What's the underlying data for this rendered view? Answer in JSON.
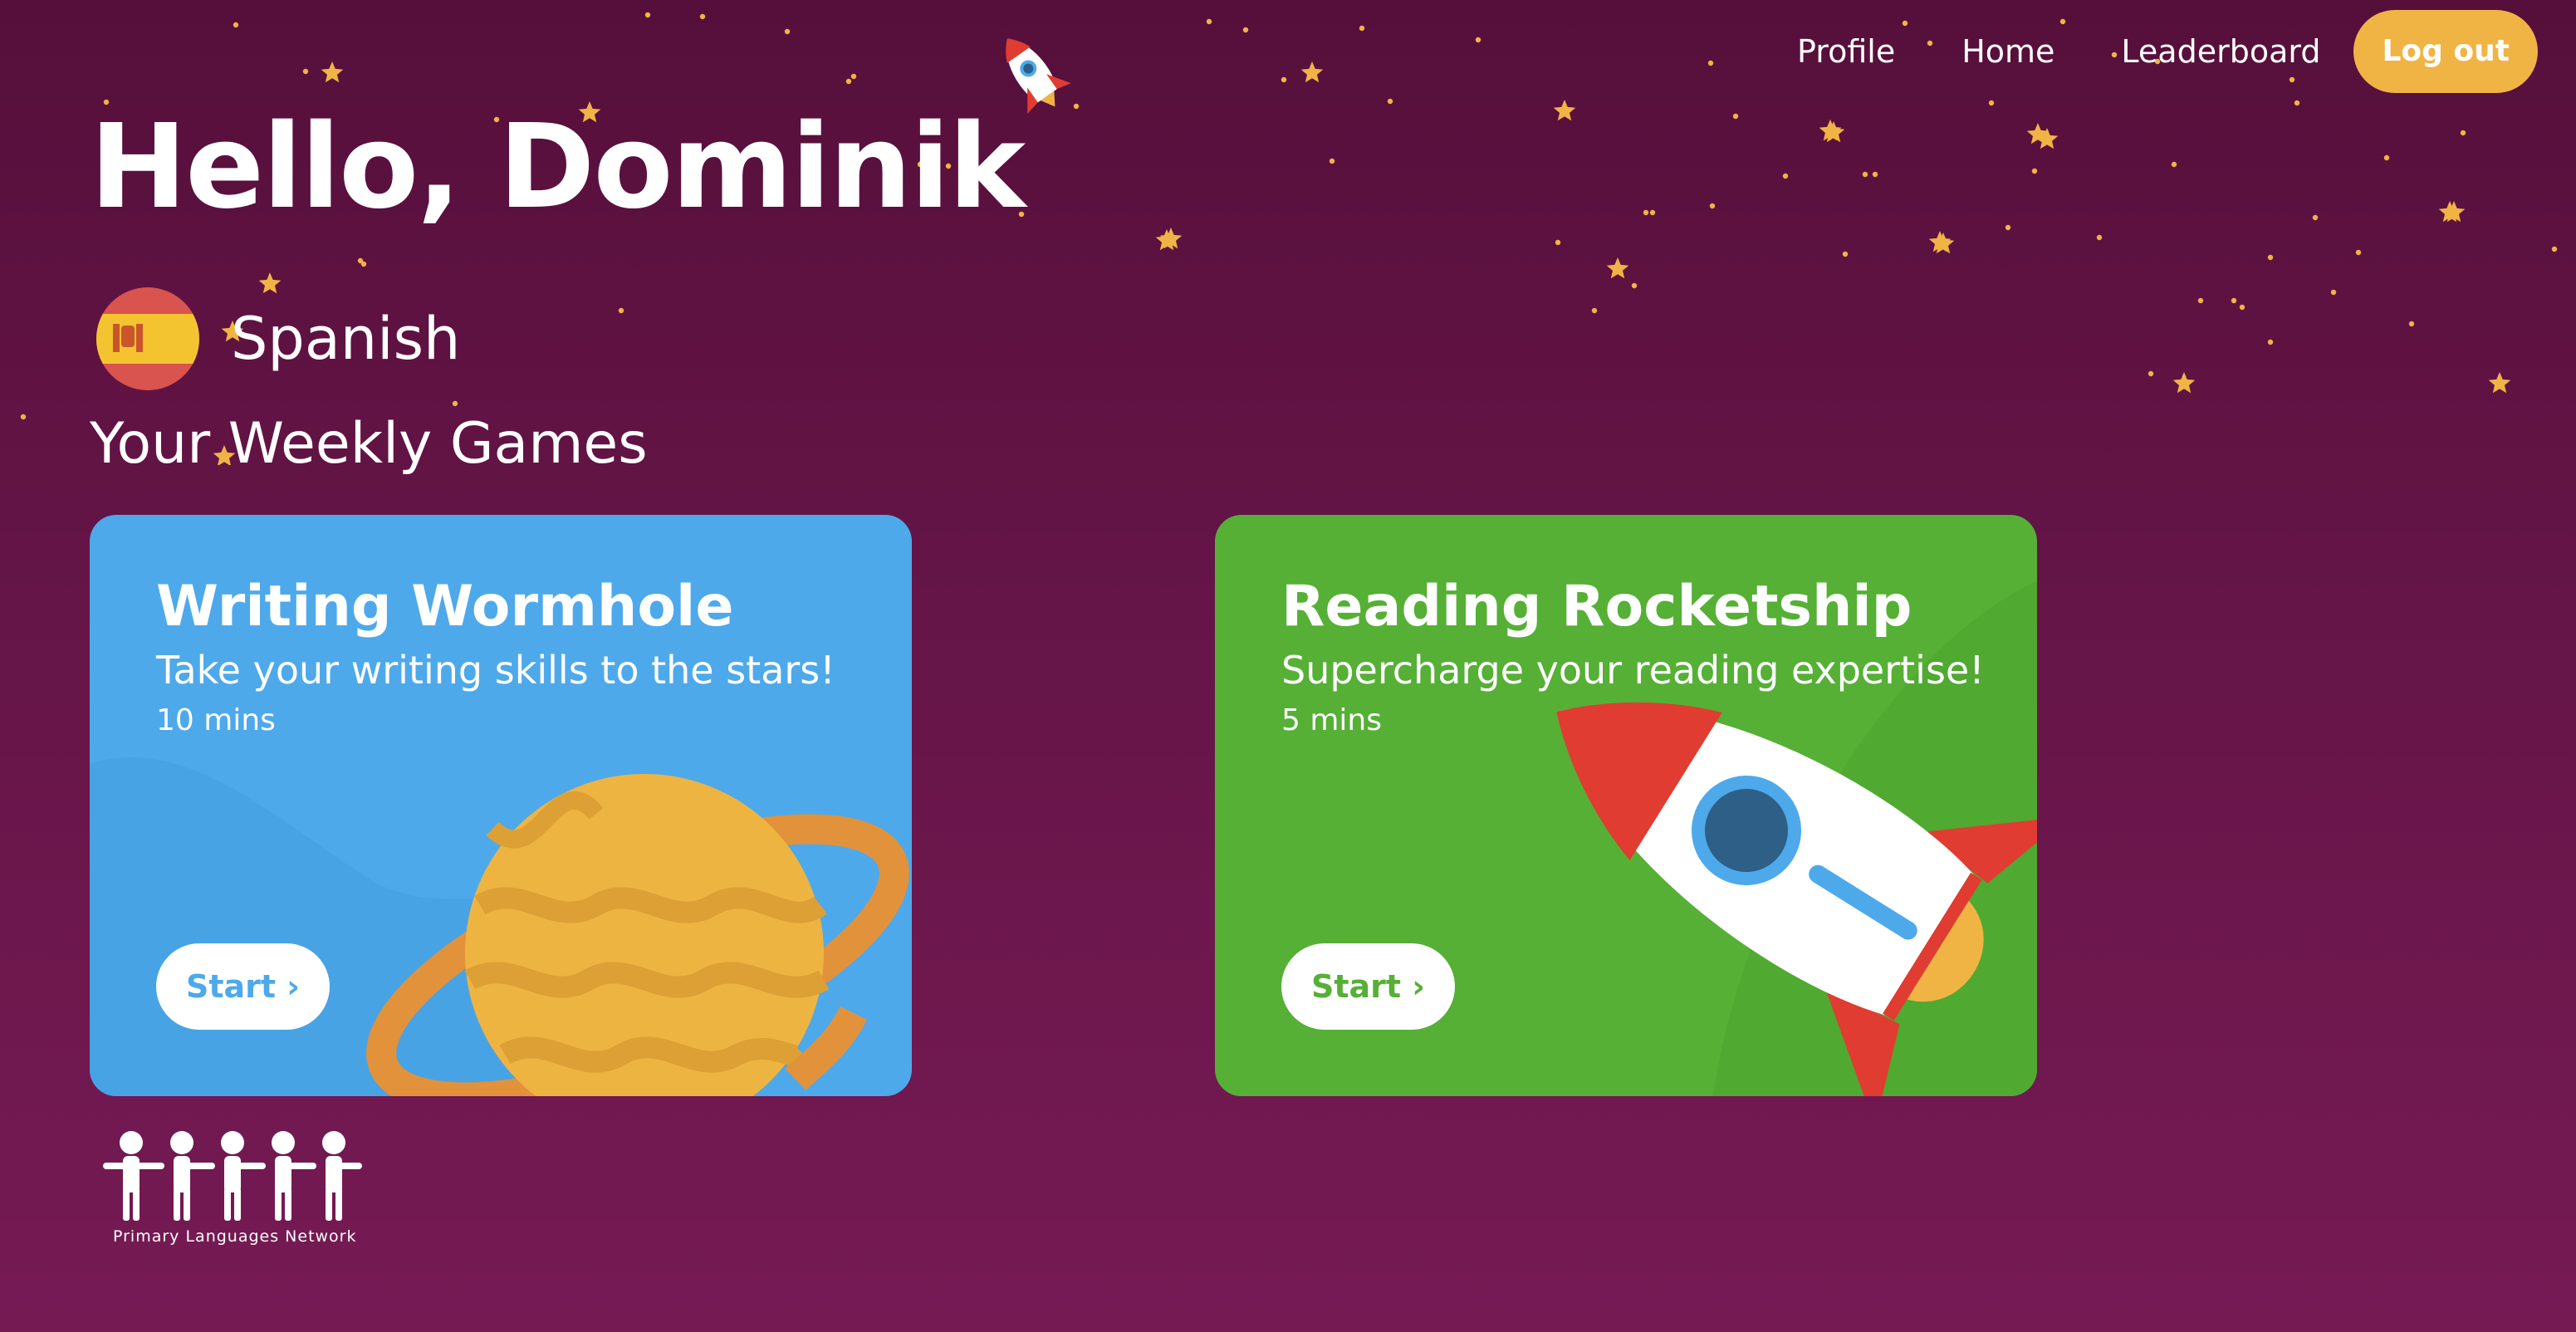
{
  "colors": {
    "background_top": "#560f3a",
    "background_bottom": "#761a54",
    "star": "#f0b445",
    "logout_button": "#f0b445",
    "card_blue": "#4ea9ea",
    "card_green": "#55b035"
  },
  "header": {
    "logo_icon": "rocket-icon",
    "nav": [
      {
        "label": "Profile"
      },
      {
        "label": "Home"
      },
      {
        "label": "Leaderboard"
      }
    ],
    "logout_label": "Log out"
  },
  "greeting": "Hello, Dominik",
  "language": {
    "name": "Spanish",
    "flag_icon": "spain-flag-icon"
  },
  "section_title": "Your Weekly Games",
  "games": [
    {
      "title": "Writing Wormhole",
      "subtitle": "Take your writing skills to the stars!",
      "duration": "10 mins",
      "start_label": "Start ›",
      "illustration": "planet-icon"
    },
    {
      "title": "Reading Rocketship",
      "subtitle": "Supercharge your reading expertise!",
      "duration": "5 mins",
      "start_label": "Start ›",
      "illustration": "rocket-icon"
    }
  ],
  "footer": {
    "logo_icon": "people-chain-icon",
    "logo_text": "Primary Languages Network"
  }
}
